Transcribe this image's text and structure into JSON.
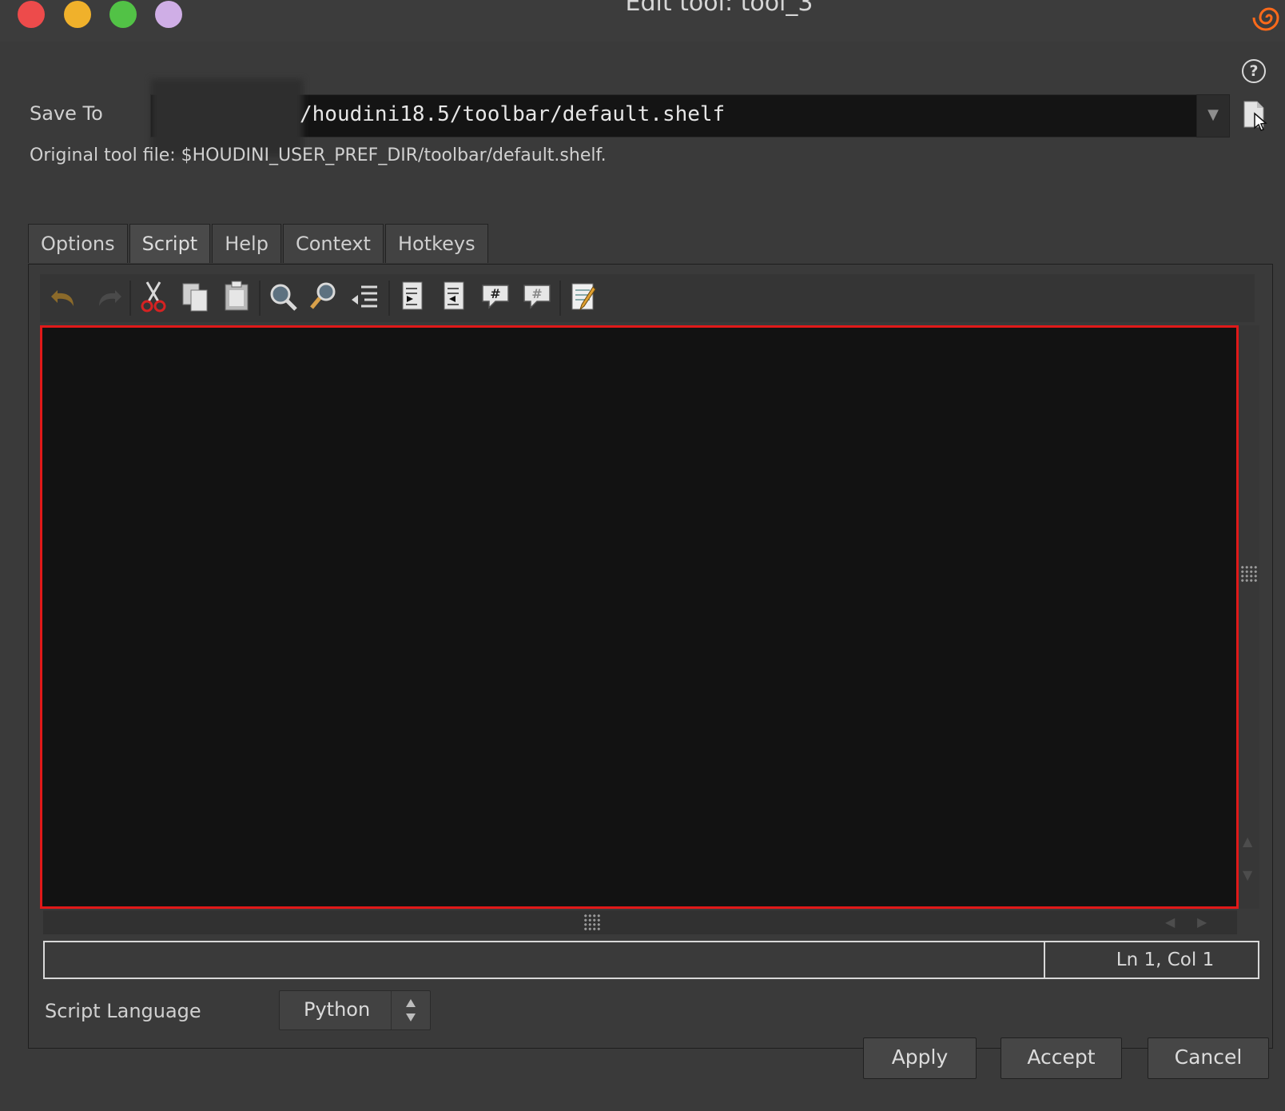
{
  "window": {
    "title": "Edit tool: tool_3"
  },
  "help": {
    "glyph": "?"
  },
  "save_to": {
    "label": "Save To",
    "value": "/houdini18.5/toolbar/default.shelf",
    "dropdown_glyph": "▼"
  },
  "original_file": "Original tool file: $HOUDINI_USER_PREF_DIR/toolbar/default.shelf.",
  "tabs": [
    {
      "label": "Options"
    },
    {
      "label": "Script"
    },
    {
      "label": "Help"
    },
    {
      "label": "Context"
    },
    {
      "label": "Hotkeys"
    }
  ],
  "active_tab": "Script",
  "toolbar": {
    "icons": [
      "undo-icon",
      "redo-icon",
      "cut-icon",
      "copy-icon",
      "paste-icon",
      "find-icon",
      "find-replace-icon",
      "goto-line-icon",
      "indent-icon",
      "unindent-icon",
      "comment-icon",
      "uncomment-icon",
      "external-editor-icon"
    ]
  },
  "editor": {
    "content": ""
  },
  "status": {
    "message": "",
    "position": "Ln 1, Col 1"
  },
  "script_language": {
    "label": "Script Language",
    "value": "Python"
  },
  "buttons": {
    "apply": "Apply",
    "accept": "Accept",
    "cancel": "Cancel"
  },
  "colors": {
    "highlight": "#e01919",
    "editor_bg": "#121212",
    "window_bg": "#3a3a3a"
  }
}
